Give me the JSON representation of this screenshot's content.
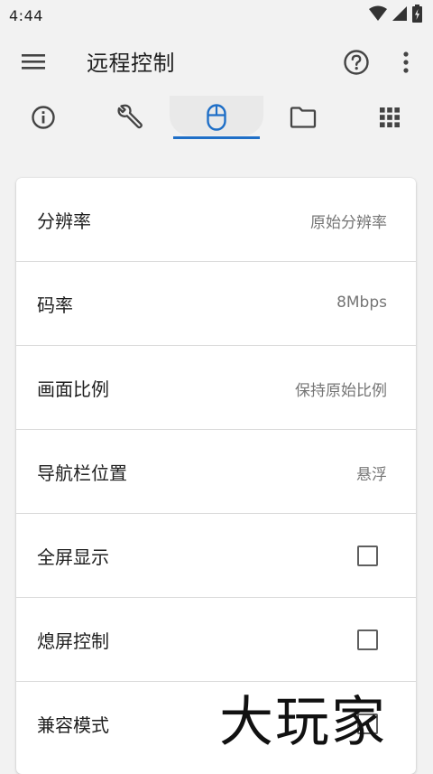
{
  "status_bar": {
    "time": "4:44"
  },
  "app_bar": {
    "title": "远程控制"
  },
  "tabs": [
    {
      "icon": "info-icon",
      "active": false
    },
    {
      "icon": "wrench-icon",
      "active": false
    },
    {
      "icon": "mouse-icon",
      "active": true
    },
    {
      "icon": "folder-icon",
      "active": false
    },
    {
      "icon": "apps-grid-icon",
      "active": false
    }
  ],
  "settings": {
    "resolution": {
      "label": "分辨率",
      "value": "原始分辨率"
    },
    "bitrate": {
      "label": "码率",
      "value": "8Mbps"
    },
    "aspect": {
      "label": "画面比例",
      "value": "保持原始比例"
    },
    "navbar": {
      "label": "导航栏位置",
      "value": "悬浮"
    },
    "fullscreen": {
      "label": "全屏显示",
      "checked": false
    },
    "screen_off": {
      "label": "熄屏控制",
      "checked": false
    },
    "compat": {
      "label": "兼容模式",
      "checked": false
    }
  },
  "watermark": "大玩家",
  "colors": {
    "accent": "#1f6fc7",
    "background": "#f2f2f2"
  }
}
